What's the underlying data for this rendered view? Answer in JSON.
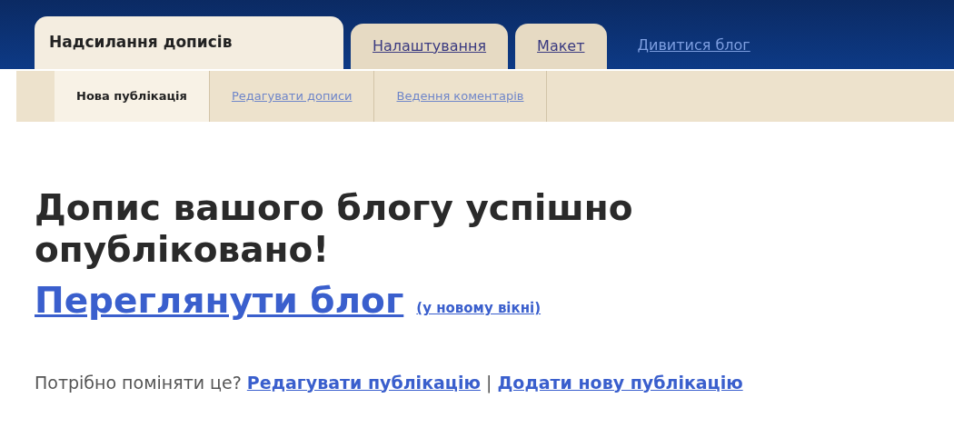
{
  "tabs": [
    {
      "label": "Надсилання дописів",
      "selected": true
    },
    {
      "label": "Налаштування",
      "selected": false
    },
    {
      "label": "Макет",
      "selected": false
    }
  ],
  "view_blog_link": "Дивитися блог",
  "subtabs": [
    {
      "label": "Нова публікація",
      "selected": true
    },
    {
      "label": "Редагувати дописи",
      "selected": false
    },
    {
      "label": "Ведення коментарів",
      "selected": false
    }
  ],
  "heading": "Допис вашого блогу успішно опубліковано!",
  "view_link": "Переглянути блог",
  "new_window_link": "(у новому вікні)",
  "footer": {
    "prompt": "Потрібно поміняти це?",
    "links": [
      "Редагувати публікацію",
      "Додати нову публікацію"
    ],
    "separator": "|"
  }
}
